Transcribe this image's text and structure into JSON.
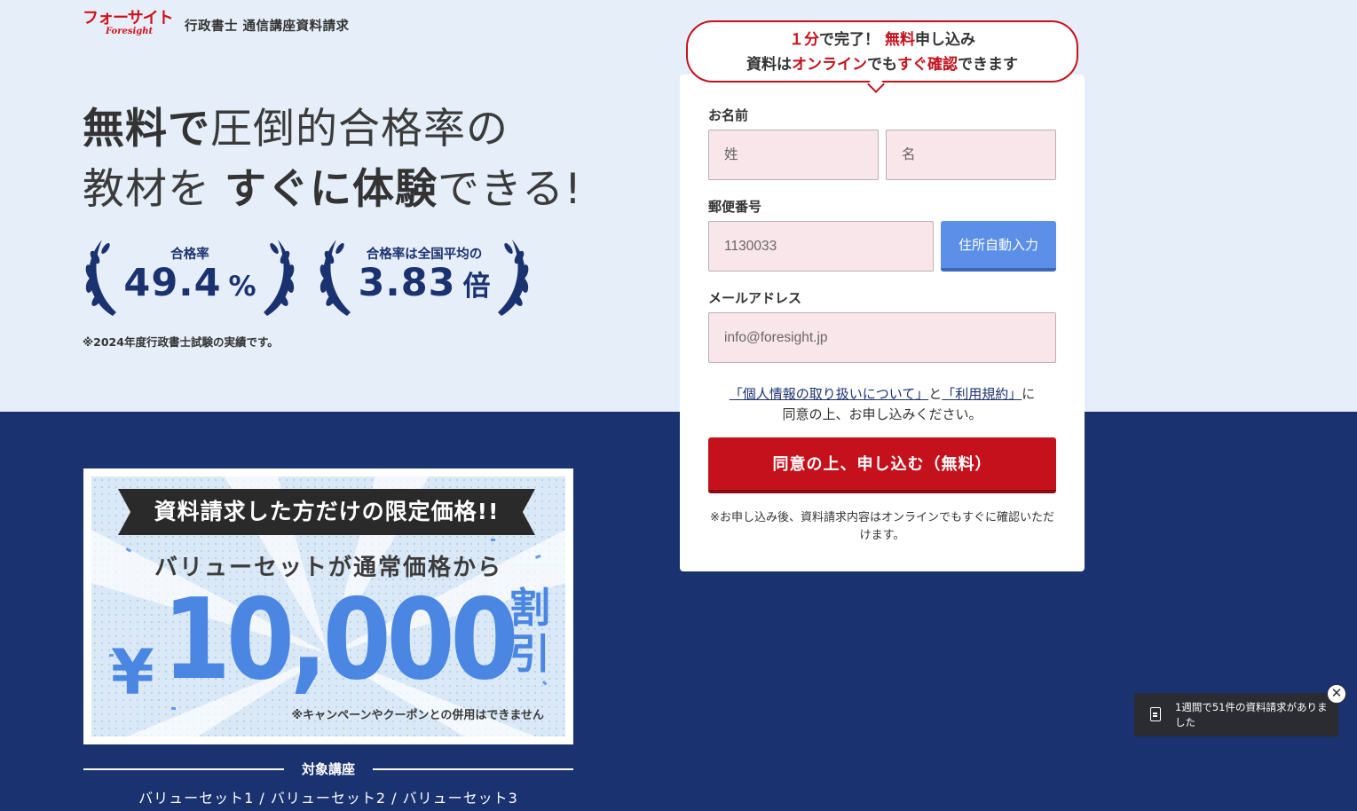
{
  "header": {
    "logo_text": "フォーサイト",
    "logo_sub": "Foresight",
    "title": "行政書士 通信講座資料請求"
  },
  "hero": {
    "part1": "無料で",
    "part2": "圧倒的合格率の",
    "part3": "教材を ",
    "part4": "すぐに体験",
    "part5": "できる!"
  },
  "stats": [
    {
      "label": "合格率",
      "value": "49.4",
      "unit": "%"
    },
    {
      "label": "合格率は全国平均の",
      "value": "3.83",
      "unit": "倍"
    }
  ],
  "stats_note": "※2024年度行政書士試験の実績です。",
  "promo": {
    "ribbon": "資料請求した方だけの限定価格!!",
    "sub": "バリューセットが通常価格から",
    "yen": "¥",
    "amount": "10,000",
    "discount": "割引",
    "note": "※キャンペーンやクーポンとの併用はできません"
  },
  "courses": {
    "title": "対象講座",
    "list": "バリューセット1 / バリューセット2 / バリューセット3"
  },
  "form": {
    "bubble_l1_red1": "１分",
    "bubble_l1_t1": "で完了！ ",
    "bubble_l1_red2": "無料",
    "bubble_l1_t2": "申し込み",
    "bubble_l2_t1": "資料は",
    "bubble_l2_red1": "オンライン",
    "bubble_l2_t2": "でも",
    "bubble_l2_red2": "すぐ確認",
    "bubble_l2_t3": "できます",
    "name_label": "お名前",
    "last_name_placeholder": "姓",
    "first_name_placeholder": "名",
    "postal_label": "郵便番号",
    "postal_value": "1130033",
    "auto_address_button": "住所自動入力",
    "email_label": "メールアドレス",
    "email_value": "info@foresight.jp",
    "privacy_link": "「個人情報の取り扱いについて」",
    "consent_and": "と",
    "terms_link": "「利用規約」",
    "consent_tail": "に",
    "consent_line2": "同意の上、お申し込みください。",
    "submit_button": "同意の上、申し込む（無料）",
    "after_note": "※お申し込み後、資料請求内容はオンラインでもすぐに確認いただけます。"
  },
  "toast": {
    "message": "1週間で51件の資料請求がありました",
    "icon": "document-icon",
    "close_icon": "close-icon"
  },
  "colors": {
    "brand_red": "#c4111c",
    "navy": "#1b3270",
    "light_bg": "#e6eff9",
    "accent_blue": "#4a86e2"
  }
}
